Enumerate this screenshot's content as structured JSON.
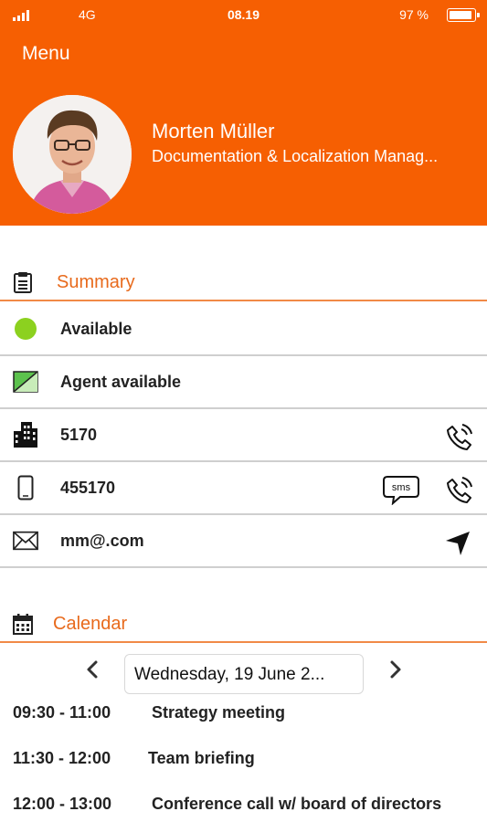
{
  "status_bar": {
    "network": "4G",
    "time": "08.19",
    "battery": "97 %",
    "battery_level_percent": 97,
    "signal_icon": "signal-bars-icon",
    "battery_icon": "battery-icon"
  },
  "header": {
    "menu_label": "Menu",
    "background_color": "#f65f02",
    "user_name": "Morten Müller",
    "user_title": "Documentation & Localization Manag..."
  },
  "summary": {
    "title": "Summary",
    "icon": "clipboard-icon",
    "accent_color": "#e86a1c",
    "rows": [
      {
        "icon": "status-dot-icon",
        "icon_color": "#8cd11f",
        "text": "Available"
      },
      {
        "icon": "agent-status-icon",
        "text": "Agent available"
      },
      {
        "icon": "office-building-icon",
        "text": "5170",
        "actions": [
          "call-icon"
        ]
      },
      {
        "icon": "mobile-phone-icon",
        "text": "455170",
        "actions": [
          "sms-icon",
          "call-icon"
        ]
      },
      {
        "icon": "envelope-icon",
        "text": "mm@.com",
        "actions": [
          "send-icon"
        ]
      }
    ],
    "sms_icon_text": "sms"
  },
  "calendar": {
    "title": "Calendar",
    "icon": "calendar-icon",
    "date_label": "Wednesday, 19 June 2...",
    "prev_icon": "chevron-left-icon",
    "next_icon": "chevron-right-icon",
    "events": [
      {
        "time": "09:30 - 11:00",
        "title": "Strategy meeting"
      },
      {
        "time": "11:30 - 12:00",
        "title": "Team briefing"
      },
      {
        "time": "12:00 - 13:00",
        "title": "Conference call w/ board of directors"
      }
    ]
  }
}
